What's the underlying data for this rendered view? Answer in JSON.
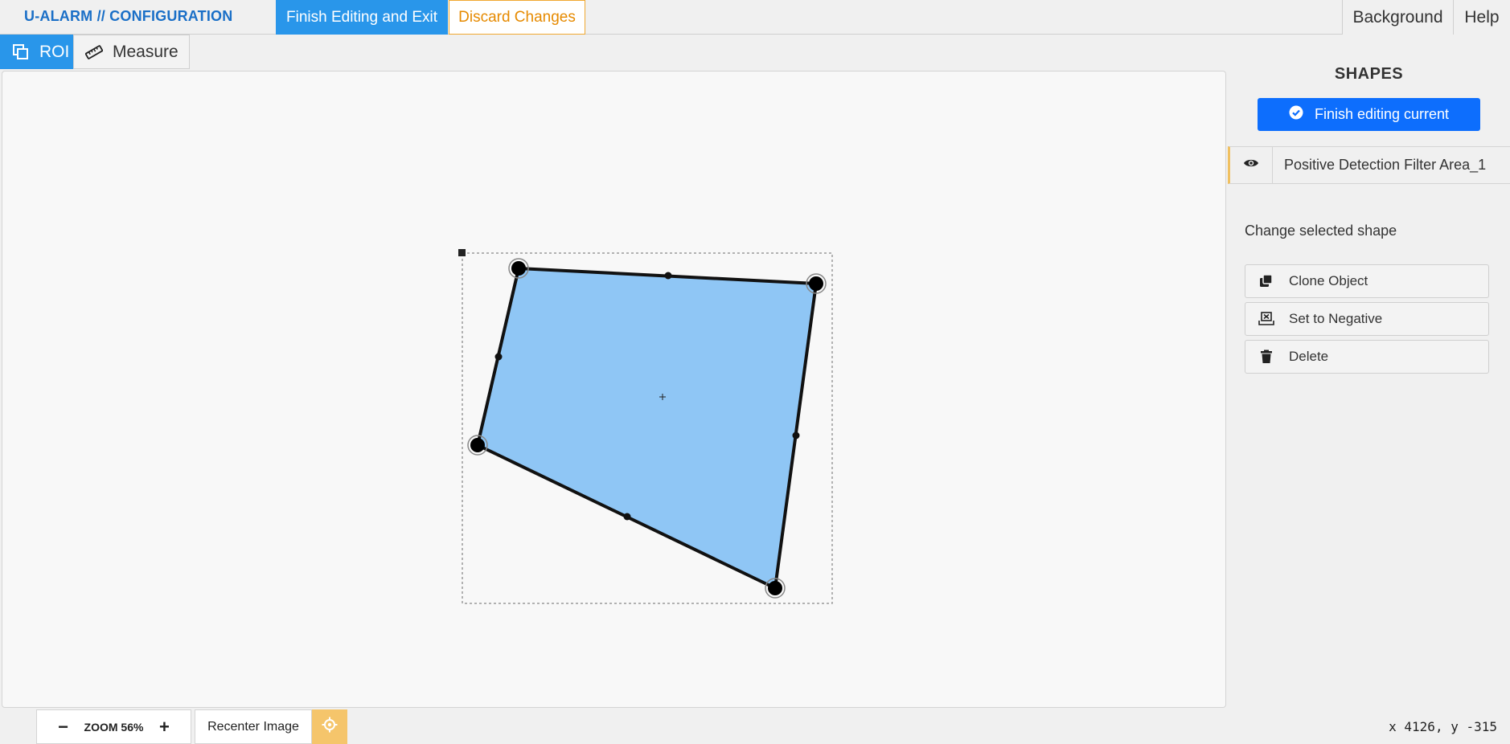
{
  "header": {
    "brand": "U-ALARM // CONFIGURATION",
    "finish_exit_label": "Finish Editing and Exit",
    "discard_label": "Discard Changes",
    "background_label": "Background",
    "help_label": "Help"
  },
  "tools": {
    "roi_label": "ROI",
    "measure_label": "Measure"
  },
  "panel": {
    "title": "SHAPES",
    "finish_current_label": "Finish editing current",
    "shape_name": "Positive Detection Filter Area_1",
    "change_label": "Change selected shape",
    "actions": [
      {
        "label": "Clone Object",
        "icon": "clone-icon"
      },
      {
        "label": "Set to Negative",
        "icon": "negative-icon"
      },
      {
        "label": "Delete",
        "icon": "trash-icon"
      }
    ]
  },
  "footer": {
    "zoom_label": "ZOOM 56%",
    "zoom_minus": "−",
    "zoom_plus": "+",
    "recenter_label": "Recenter Image",
    "coords": "x 4126, y -315"
  },
  "colors": {
    "accent": "#2996ea",
    "primary": "#0d6efd",
    "warning": "#e68a00",
    "shape_fill": "#8fc6f5",
    "recenter_bg": "#f5c56b"
  }
}
